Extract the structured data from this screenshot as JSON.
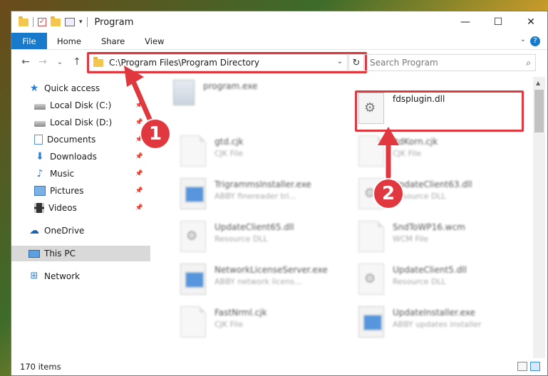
{
  "window": {
    "title": "Program",
    "controls": {
      "minimize": "—",
      "maximize": "☐",
      "close": "✕"
    }
  },
  "ribbon": {
    "tabs": [
      "File",
      "Home",
      "Share",
      "View"
    ],
    "help": "?"
  },
  "nav": {
    "address": "C:\\Program Files\\Program Directory",
    "search_placeholder": "Search Program"
  },
  "sidebar": {
    "items": [
      {
        "label": "Quick access",
        "icon": "star-icon",
        "pinned": false
      },
      {
        "label": "Local Disk (C:)",
        "icon": "disk-icon",
        "pinned": true
      },
      {
        "label": "Local Disk (D:)",
        "icon": "disk-icon",
        "pinned": true
      },
      {
        "label": "Documents",
        "icon": "document-icon",
        "pinned": true
      },
      {
        "label": "Downloads",
        "icon": "download-icon",
        "pinned": true
      },
      {
        "label": "Music",
        "icon": "music-icon",
        "pinned": true
      },
      {
        "label": "Pictures",
        "icon": "pictures-icon",
        "pinned": true
      },
      {
        "label": "Videos",
        "icon": "videos-icon",
        "pinned": true
      },
      {
        "label": "OneDrive",
        "icon": "cloud-icon",
        "pinned": false
      },
      {
        "label": "This PC",
        "icon": "computer-icon",
        "pinned": false
      },
      {
        "label": "Network",
        "icon": "network-icon",
        "pinned": false
      }
    ]
  },
  "files": [
    {
      "name": "program.exe",
      "type": "",
      "kind": "exe-top"
    },
    {
      "name": "fdsplugin.dll",
      "type": "",
      "kind": "dll"
    },
    {
      "name": "gtd.cjk",
      "type": "CJK File",
      "kind": "page"
    },
    {
      "name": "ltdKorn.cjk",
      "type": "CJK File",
      "kind": "page"
    },
    {
      "name": "TrigrammsInstaller.exe",
      "type": "ABBY finereader tri...",
      "kind": "app"
    },
    {
      "name": "UpdateClient63.dll",
      "type": "Resource DLL",
      "kind": "dll"
    },
    {
      "name": "UpdateClient65.dll",
      "type": "Resource DLL",
      "kind": "dll"
    },
    {
      "name": "SndToWP16.wcm",
      "type": "WCM File",
      "kind": "page"
    },
    {
      "name": "NetworkLicenseServer.exe",
      "type": "ABBY network licens...",
      "kind": "app"
    },
    {
      "name": "UpdateClient5.dll",
      "type": "Resource DLL",
      "kind": "dll"
    },
    {
      "name": "FastNrml.cjk",
      "type": "CJK File",
      "kind": "page"
    },
    {
      "name": "UpdateInstaller.exe",
      "type": "ABBY updates installer",
      "kind": "app"
    }
  ],
  "status": {
    "count": "170 items"
  },
  "annotations": {
    "marker1": "1",
    "marker2": "2",
    "color": "#e0383e"
  }
}
